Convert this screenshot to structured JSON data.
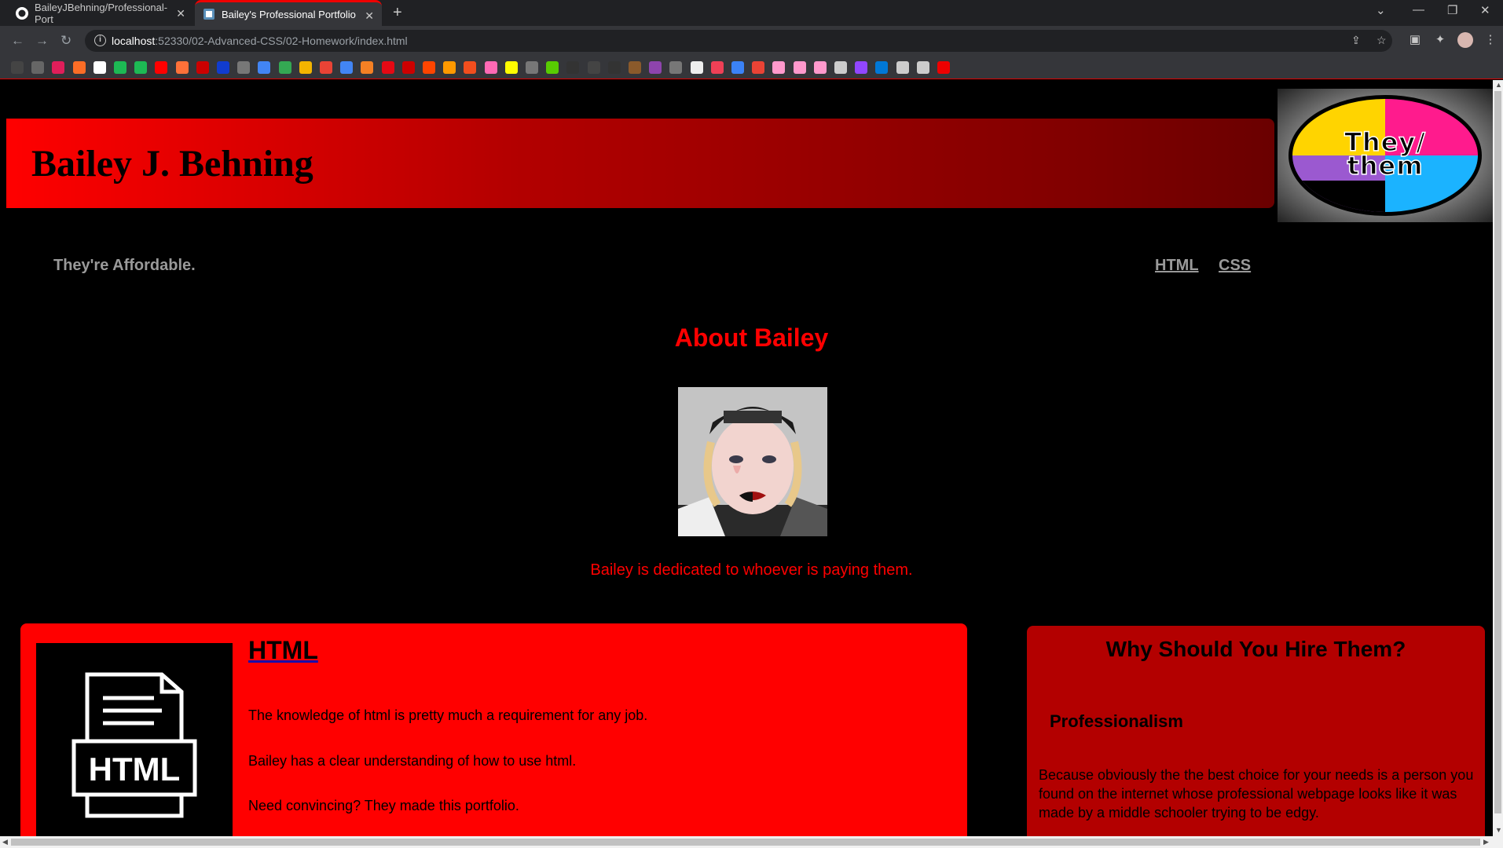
{
  "browser": {
    "tabs": [
      {
        "title": "BaileyJBehning/Professional-Port",
        "icon": "github-icon",
        "active": false
      },
      {
        "title": "Bailey's Professional Portfolio",
        "icon": "page-icon",
        "active": true
      }
    ],
    "url_host": "localhost",
    "url_path": ":52330/02-Advanced-CSS/02-Homework/index.html",
    "bookmark_icons": [
      "d",
      "wp",
      "slack",
      "gitlab",
      "github",
      "w",
      "spotify",
      "youtube",
      "firefox",
      "scribble",
      "d+",
      "wp",
      "google",
      "maps",
      "notes",
      "gmail",
      "translate",
      "stack",
      "netflix",
      "pos",
      "reddit",
      "amz",
      "figma",
      "brain",
      "snap",
      "wp",
      "duo",
      "sq",
      "ht",
      "sq",
      "bear",
      "v",
      "wp",
      "doc",
      "pocket",
      "globe",
      "pin",
      "doc",
      "doc",
      "doc",
      "doc",
      "twitch",
      "edge",
      "doc",
      "doc",
      "fz"
    ]
  },
  "header": {
    "title": "Bailey J. Behning",
    "pronoun_badge": "They/them"
  },
  "nav": {
    "tagline": "They're Affordable.",
    "links": [
      "HTML",
      "CSS"
    ]
  },
  "about": {
    "title": "About Bailey",
    "text": "Bailey is dedicated to whoever is paying them."
  },
  "html_card": {
    "title": "HTML",
    "icon_label": "HTML",
    "paragraphs": [
      "The knowledge of html is pretty much a requirement for any job.",
      "Bailey has a clear understanding of how to use html.",
      "Need convincing? They made this portfolio."
    ]
  },
  "hire_card": {
    "title": "Why Should You Hire Them?",
    "subtitle": "Professionalism",
    "text": "Because obviously the the best choice for your needs is a person you found on the internet whose professional webpage looks like it was made by a middle schooler trying to be edgy."
  },
  "colors": {
    "accent": "#ff0000",
    "dark_red": "#b30000",
    "background": "#000000"
  }
}
